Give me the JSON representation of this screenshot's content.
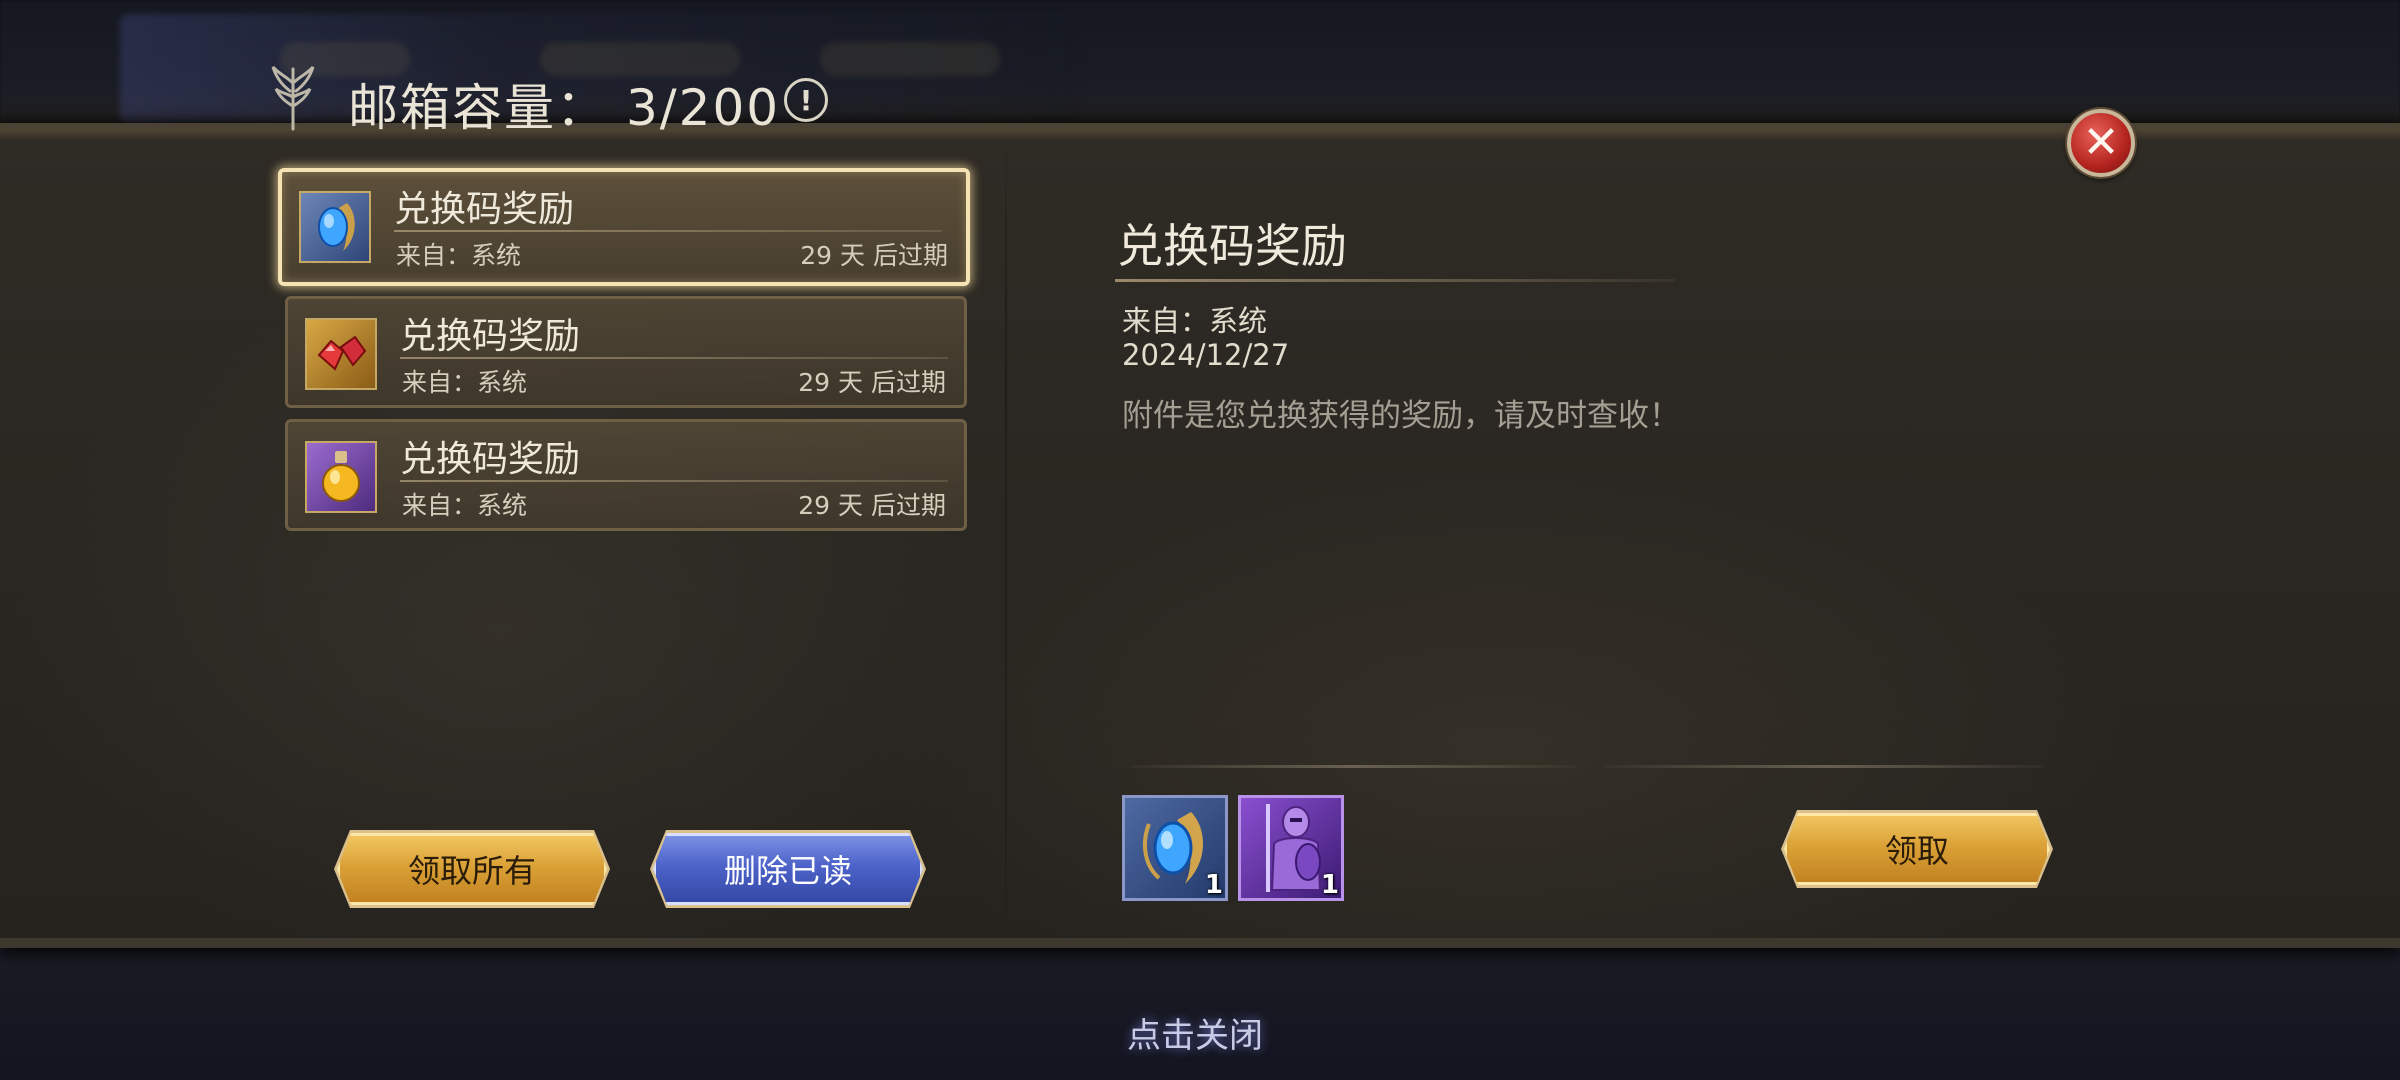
{
  "header": {
    "title": "邮箱容量：",
    "capacity": "3/200",
    "info_icon": "!"
  },
  "close_icon": "✕",
  "mail_list": [
    {
      "title": "兑换码奖励",
      "from": "来自：系统",
      "expire": "29 天 后过期",
      "icon": "blue-gem-icon",
      "selected": true
    },
    {
      "title": "兑换码奖励",
      "from": "来自：系统",
      "expire": "29 天 后过期",
      "icon": "red-gems-icon",
      "selected": false
    },
    {
      "title": "兑换码奖励",
      "from": "来自：系统",
      "expire": "29 天 后过期",
      "icon": "gold-potion-icon",
      "selected": false
    }
  ],
  "buttons": {
    "claim_all": "领取所有",
    "delete_read": "删除已读",
    "claim": "领取"
  },
  "detail": {
    "title": "兑换码奖励",
    "from": "来自：系统",
    "date": "2024/12/27",
    "body": "附件是您兑换获得的奖励，请及时查收！"
  },
  "attachments": [
    {
      "icon": "blue-gem-icon",
      "qty": "1"
    },
    {
      "icon": "purple-knight-icon",
      "qty": "1"
    }
  ],
  "footer": {
    "tap_close": "点击关闭"
  },
  "colors": {
    "panel": "#2b2823",
    "gold_button": "#dba237",
    "blue_button": "#4d63c9",
    "close_red": "#b4241f",
    "selected_glow": "#f5e3b4"
  }
}
